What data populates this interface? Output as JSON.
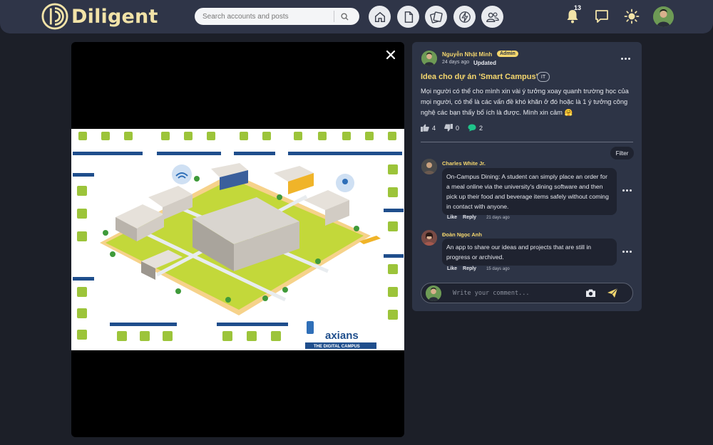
{
  "app": {
    "name": "Diligent",
    "search_placeholder": "Search accounts and posts",
    "nav": [
      {
        "icon": "home-icon"
      },
      {
        "icon": "document-icon"
      },
      {
        "icon": "cards-icon"
      },
      {
        "icon": "lightning-icon"
      },
      {
        "icon": "users-icon"
      }
    ],
    "notification_count": "13",
    "accent_color": "#f5d76e"
  },
  "viewer": {
    "image_label": "Smart campus illustration"
  },
  "post": {
    "author": "Nguyễn Nhật Minh",
    "role_badge": "Admin",
    "time": "24 days ago",
    "updated": "Updated",
    "title": "Idea cho dự án 'Smart Campus'",
    "tag": "IT",
    "body": "Mọi người có thể cho mình xin vài ý tưởng xoay quanh trường học của mọi người, có thể là các vấn đề khó khăn ở đó hoặc là 1 ý tưởng công nghệ các bạn thấy bổ ích là được. Mình xin cảm 🤗",
    "likes": "4",
    "dislikes": "0",
    "comments_count": "2",
    "filter_label": "Filter",
    "comments": [
      {
        "author": "Charles White Jr.",
        "text": "On-Campus Dining: A student can simply place an order for a meal online via the university's dining software and then pick up their food and beverage items safely without coming in contact with anyone.",
        "like": "Like",
        "reply": "Reply",
        "time": "21 days ago"
      },
      {
        "author": "Đoàn Ngọc Anh",
        "text": "An app to share our ideas and projects that are still in progress or archived.",
        "like": "Like",
        "reply": "Reply",
        "time": "15 days ago"
      }
    ],
    "composer_placeholder": "Write your comment..."
  }
}
